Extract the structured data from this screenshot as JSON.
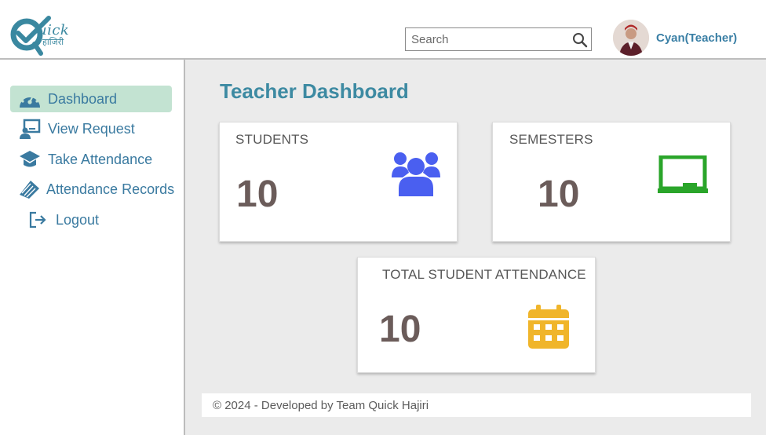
{
  "brand": {
    "logo_text": "uick",
    "logo_sub": "हाजिरी"
  },
  "search": {
    "placeholder": "Search",
    "value": ""
  },
  "user": {
    "name": "Cyan(Teacher)"
  },
  "sidebar": {
    "items": [
      {
        "label": "Dashboard",
        "icon": "dashboard-gauge-icon",
        "active": true
      },
      {
        "label": "View Request",
        "icon": "request-icon",
        "active": false
      },
      {
        "label": "Take Attendance",
        "icon": "graduation-cap-icon",
        "active": false
      },
      {
        "label": "Attendance Records",
        "icon": "books-icon",
        "active": false
      },
      {
        "label": "Logout",
        "icon": "logout-icon",
        "active": false
      }
    ]
  },
  "main": {
    "title": "Teacher Dashboard",
    "cards": [
      {
        "label": "STUDENTS",
        "value": "10",
        "icon": "users-icon",
        "color": "#4a5ff0"
      },
      {
        "label": "SEMESTERS",
        "value": "10",
        "icon": "chalkboard-icon",
        "color": "#2aa52a"
      },
      {
        "label": "TOTAL STUDENT ATTENDANCE",
        "value": "10",
        "icon": "calendar-icon",
        "color": "#f0b52a"
      }
    ]
  },
  "footer": {
    "text": "© 2024 - Developed by Team Quick Hajiri"
  },
  "colors": {
    "accent": "#3d8aa2",
    "sidebar_active": "#c3e3d2",
    "value_text": "#6b5c5a"
  }
}
